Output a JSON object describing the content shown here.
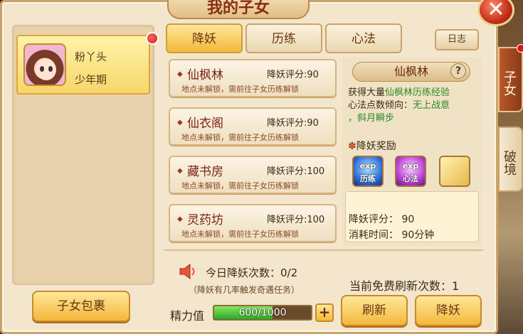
{
  "header": {
    "title": "我的子女",
    "close_label": "✕"
  },
  "child": {
    "name": "粉丫头",
    "stage": "少年期"
  },
  "left": {
    "bag_button": "子女包裹"
  },
  "tabs": [
    {
      "label": "降妖",
      "active": true
    },
    {
      "label": "历练",
      "active": false
    },
    {
      "label": "心法",
      "active": false
    }
  ],
  "log_button": "日志",
  "locations": [
    {
      "name": "仙枫林",
      "score": "降妖评分:90",
      "hint": "地点未解锁，需前往子女历练解锁"
    },
    {
      "name": "仙衣阁",
      "score": "降妖评分:90",
      "hint": "地点未解锁，需前往子女历练解锁"
    },
    {
      "name": "藏书房",
      "score": "降妖评分:100",
      "hint": "地点未解锁，需前往子女历练解锁"
    },
    {
      "name": "灵药坊",
      "score": "降妖评分:100",
      "hint": "地点未解锁，需前往子女历练解锁"
    }
  ],
  "detail": {
    "title": "仙枫林",
    "help": "?",
    "desc_prefix": "获得大量",
    "desc_highlight": "仙枫林历练经验",
    "tendency_prefix": "心法点数倾向：",
    "tendency_highlight": "无上战意",
    "tendency_cont": "，斜月瞬步",
    "reward_head": "降妖奖励",
    "rewards": [
      {
        "top": "exp",
        "label": "历练"
      },
      {
        "top": "exp",
        "label": "心法"
      },
      {
        "top": "",
        "label": ""
      }
    ],
    "score_line": "降妖评分：  90",
    "time_line": "消耗时间：  90分钟"
  },
  "bottom": {
    "daily_count": "今日降妖次数：0/2",
    "daily_note": "（降妖有几率触发奇遇任务）",
    "free_refresh": "当前免费刷新次数：1",
    "energy_label": "精力值",
    "energy_text": "600/1000",
    "energy_fraction": 0.6,
    "plus_label": "+",
    "refresh_button": "刷新",
    "subdue_button": "降妖"
  },
  "side_tabs": [
    {
      "label": "子女",
      "active": true
    },
    {
      "label": "破境",
      "active": false
    }
  ]
}
